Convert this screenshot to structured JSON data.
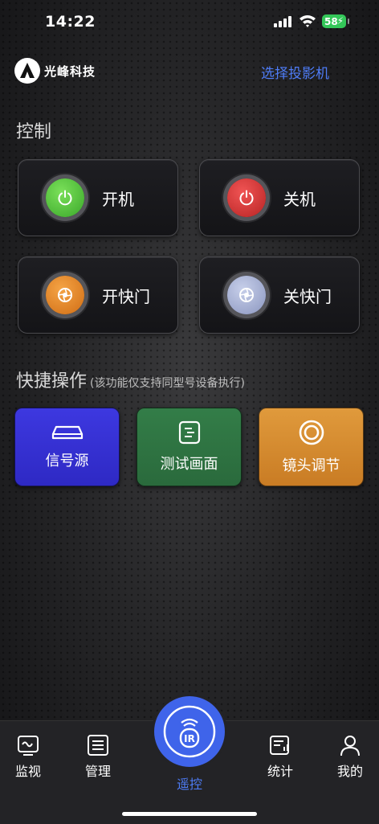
{
  "status_bar": {
    "time": "14:22",
    "battery": "58"
  },
  "header": {
    "logo_text": "光峰科技",
    "select_projector": "选择投影机"
  },
  "control": {
    "title": "控制",
    "buttons": [
      {
        "label": "开机",
        "color": "#4cc23a",
        "icon": "power-icon"
      },
      {
        "label": "关机",
        "color": "#d93434",
        "icon": "power-icon"
      },
      {
        "label": "开快门",
        "color": "#e8892a",
        "icon": "shutter-icon"
      },
      {
        "label": "关快门",
        "color": "#a9b4d6",
        "icon": "shutter-icon"
      }
    ]
  },
  "quick": {
    "title": "快捷操作",
    "subtitle": "(该功能仅支持同型号设备执行)",
    "buttons": [
      {
        "label": "信号源",
        "color": "#3a33d8",
        "icon": "input-source-icon"
      },
      {
        "label": "测试画面",
        "color": "#2f7a44",
        "icon": "test-pattern-icon"
      },
      {
        "label": "镜头调节",
        "color": "#d98c2f",
        "icon": "lens-icon"
      }
    ]
  },
  "tabbar": {
    "tabs": [
      {
        "label": "监视",
        "icon": "monitor-icon"
      },
      {
        "label": "管理",
        "icon": "manage-icon"
      },
      {
        "label": "遥控",
        "icon": "ir-remote-icon",
        "active": true
      },
      {
        "label": "统计",
        "icon": "stats-icon"
      },
      {
        "label": "我的",
        "icon": "profile-icon"
      }
    ],
    "ir_text": "IR",
    "active_color": "#4e7cf6"
  }
}
